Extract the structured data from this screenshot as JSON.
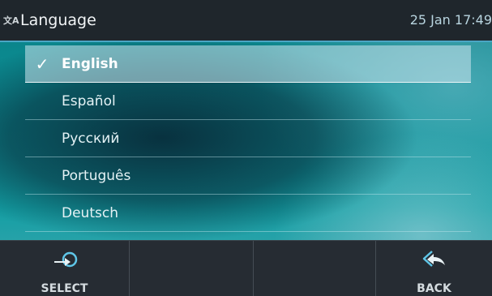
{
  "header": {
    "icon": "language-icon",
    "icon_glyph": "文A",
    "title": "Language",
    "time": "25 Jan 17:49"
  },
  "languages": [
    {
      "label": "English",
      "selected": true
    },
    {
      "label": "Español",
      "selected": false
    },
    {
      "label": "Русский",
      "selected": false
    },
    {
      "label": "Português",
      "selected": false
    },
    {
      "label": "Deutsch",
      "selected": false
    }
  ],
  "softkeys": {
    "select": {
      "label": "SELECT",
      "icon": "select-arrow-icon"
    },
    "back": {
      "label": "BACK",
      "icon": "back-arrow-icon"
    }
  },
  "colors": {
    "header_bg": "#1f262c",
    "accent": "#4aa6c4",
    "softkey_bg": "#262c33"
  }
}
